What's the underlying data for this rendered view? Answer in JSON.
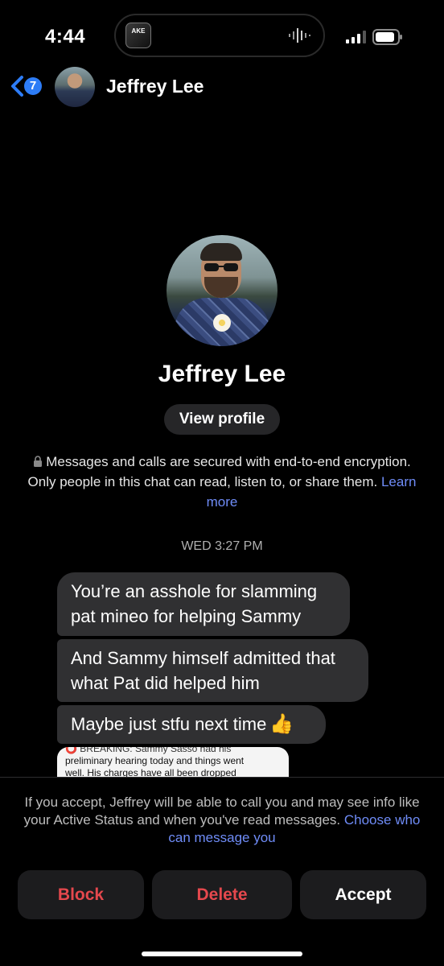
{
  "status_bar": {
    "time": "4:44",
    "island_thumb_text": "ΑΚΕ"
  },
  "header": {
    "back_badge_count": "7",
    "contact_name": "Jeffrey Lee"
  },
  "profile": {
    "name": "Jeffrey Lee",
    "view_profile_label": "View profile",
    "encryption_text": "Messages and calls are secured with end-to-end encryption. Only people in this chat can read, listen to, or share them.",
    "learn_more_label": "Learn more"
  },
  "conversation": {
    "timestamp": "WED 3:27 PM",
    "messages": [
      {
        "text": "You’re an asshole for slamming pat mineo for helping Sammy"
      },
      {
        "text": "And Sammy himself admitted that what Pat did helped him"
      },
      {
        "text": "Maybe just stfu next time",
        "emoji": "👍"
      }
    ],
    "shared_preview": {
      "line1": "⭕ BREAKING: Sammy Sasso had his",
      "line2": "preliminary hearing today and things went",
      "line3": "well. His charges have all been dropped"
    }
  },
  "request_footer": {
    "notice_text": "If you accept, Jeffrey will be able to call you and may see info like your Active Status and when you've read messages.",
    "choose_link": "Choose who can message you",
    "block_label": "Block",
    "delete_label": "Delete",
    "accept_label": "Accept"
  },
  "colors": {
    "background": "#000000",
    "bubble": "#303032",
    "link": "#6f8cf7",
    "danger": "#e5484d",
    "badge": "#2d7cf6"
  },
  "icons": [
    "back-chevron-icon",
    "signal-icon",
    "battery-icon",
    "waveform-icon",
    "lock-icon"
  ]
}
